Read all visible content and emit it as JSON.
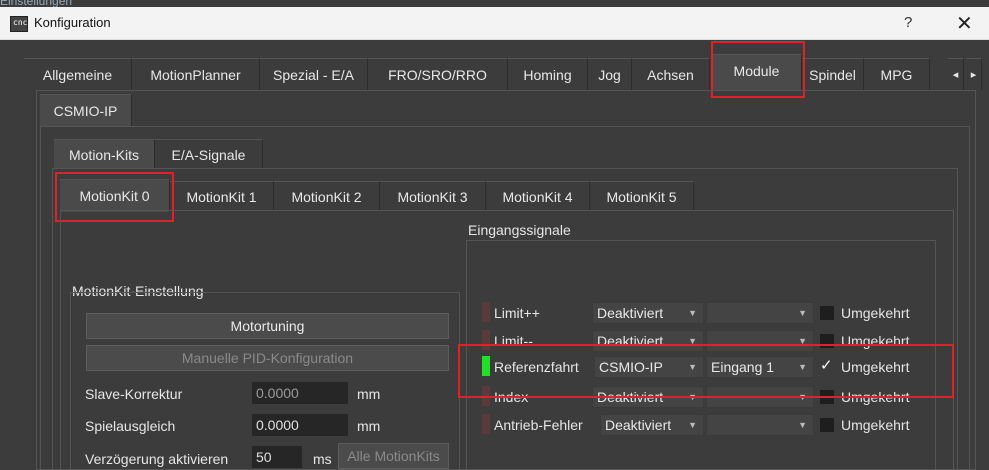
{
  "background_text": "Einstellungen",
  "window": {
    "title": "Konfiguration",
    "help": "?",
    "close": "✕",
    "app_icon": "cnc-icon"
  },
  "top_tabs": [
    "Allgemeine",
    "MotionPlanner",
    "Spezial - E/A",
    "FRO/SRO/RRO",
    "Homing",
    "Jog",
    "Achsen",
    "Module",
    "Spindel",
    "MPG"
  ],
  "top_tabs_selected": "Module",
  "scroll_arrows": {
    "left": "◂",
    "right": "▸"
  },
  "module_tab": "CSMIO-IP",
  "sub_tabs": [
    "Motion-Kits",
    "E/A-Signale"
  ],
  "kit_tabs": [
    "MotionKit 0",
    "MotionKit 1",
    "MotionKit 2",
    "MotionKit 3",
    "MotionKit 4",
    "MotionKit 5"
  ],
  "left_group": {
    "title": "MotionKit-Einstellung",
    "motortuning": "Motortuning",
    "pid": "Manuelle PID-Konfiguration",
    "rows": [
      {
        "label": "Slave-Korrektur",
        "value": "0.0000",
        "unit": "mm"
      },
      {
        "label": "Spielausgleich",
        "value": "0.0000",
        "unit": "mm"
      },
      {
        "label": "Verzögerung aktivieren",
        "value": "50",
        "unit": "ms",
        "button": "Alle MotionKits"
      }
    ]
  },
  "input_group": {
    "title": "Eingangssignale",
    "rows": [
      {
        "name": "Limit++",
        "source": "Deaktiviert",
        "input": "",
        "inverted": "Umgekehrt",
        "checked": false,
        "active": false
      },
      {
        "name": "Limit--",
        "source": "Deaktiviert",
        "input": "",
        "inverted": "Umgekehrt",
        "checked": false,
        "active": false
      },
      {
        "name": "Referenzfahrt",
        "source": "CSMIO-IP",
        "input": "Eingang 1",
        "inverted": "Umgekehrt",
        "checked": true,
        "active": true
      },
      {
        "name": "Index",
        "source": "Deaktiviert",
        "input": "",
        "inverted": "Umgekehrt",
        "checked": false,
        "active": false
      },
      {
        "name": "Antrieb-Fehler",
        "source": "Deaktiviert",
        "input": "",
        "inverted": "Umgekehrt",
        "checked": false,
        "active": false
      }
    ]
  },
  "colors": {
    "highlight": "#e0202a",
    "led_on": "#22e02a",
    "led_off": "#5a3a3a"
  }
}
